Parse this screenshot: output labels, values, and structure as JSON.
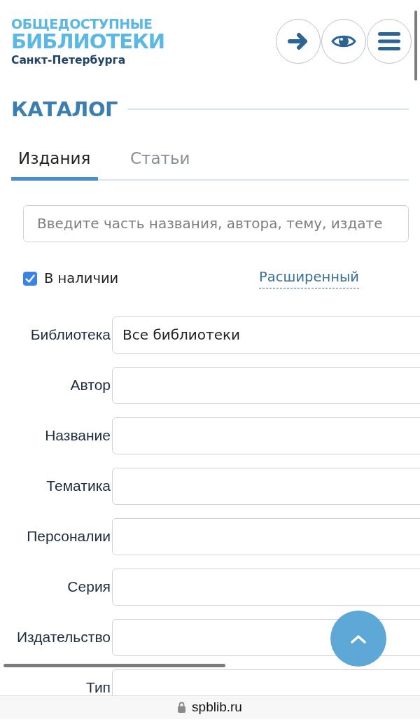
{
  "logo": {
    "line_1": "ОБЩЕДОСТУПНЫЕ",
    "line_2": "БИБЛИОТЕКИ",
    "line_3": "Санкт-Петербурга"
  },
  "header_buttons": [
    {
      "kind": "login"
    },
    {
      "kind": "accessibility"
    },
    {
      "kind": "menu"
    }
  ],
  "section_title": "КАТАЛОГ",
  "tabs": [
    {
      "label": "Издания",
      "selected": true
    },
    {
      "label": "Статьи",
      "selected": false
    }
  ],
  "search": {
    "placeholder": "Введите часть названия, автора, тему, издате"
  },
  "in_stock": {
    "label": "В наличии",
    "checked": true
  },
  "advanced_link": "Расширенный",
  "fields": [
    {
      "label": "Библиотека",
      "value": "Все библиотеки"
    },
    {
      "label": "Автор"
    },
    {
      "label": "Название"
    },
    {
      "label": "Тематика"
    },
    {
      "label": "Персоналии"
    },
    {
      "label": "Серия"
    },
    {
      "label": "Издательство"
    },
    {
      "label": "Тип"
    }
  ],
  "browser": {
    "url": "spblib.ru"
  }
}
